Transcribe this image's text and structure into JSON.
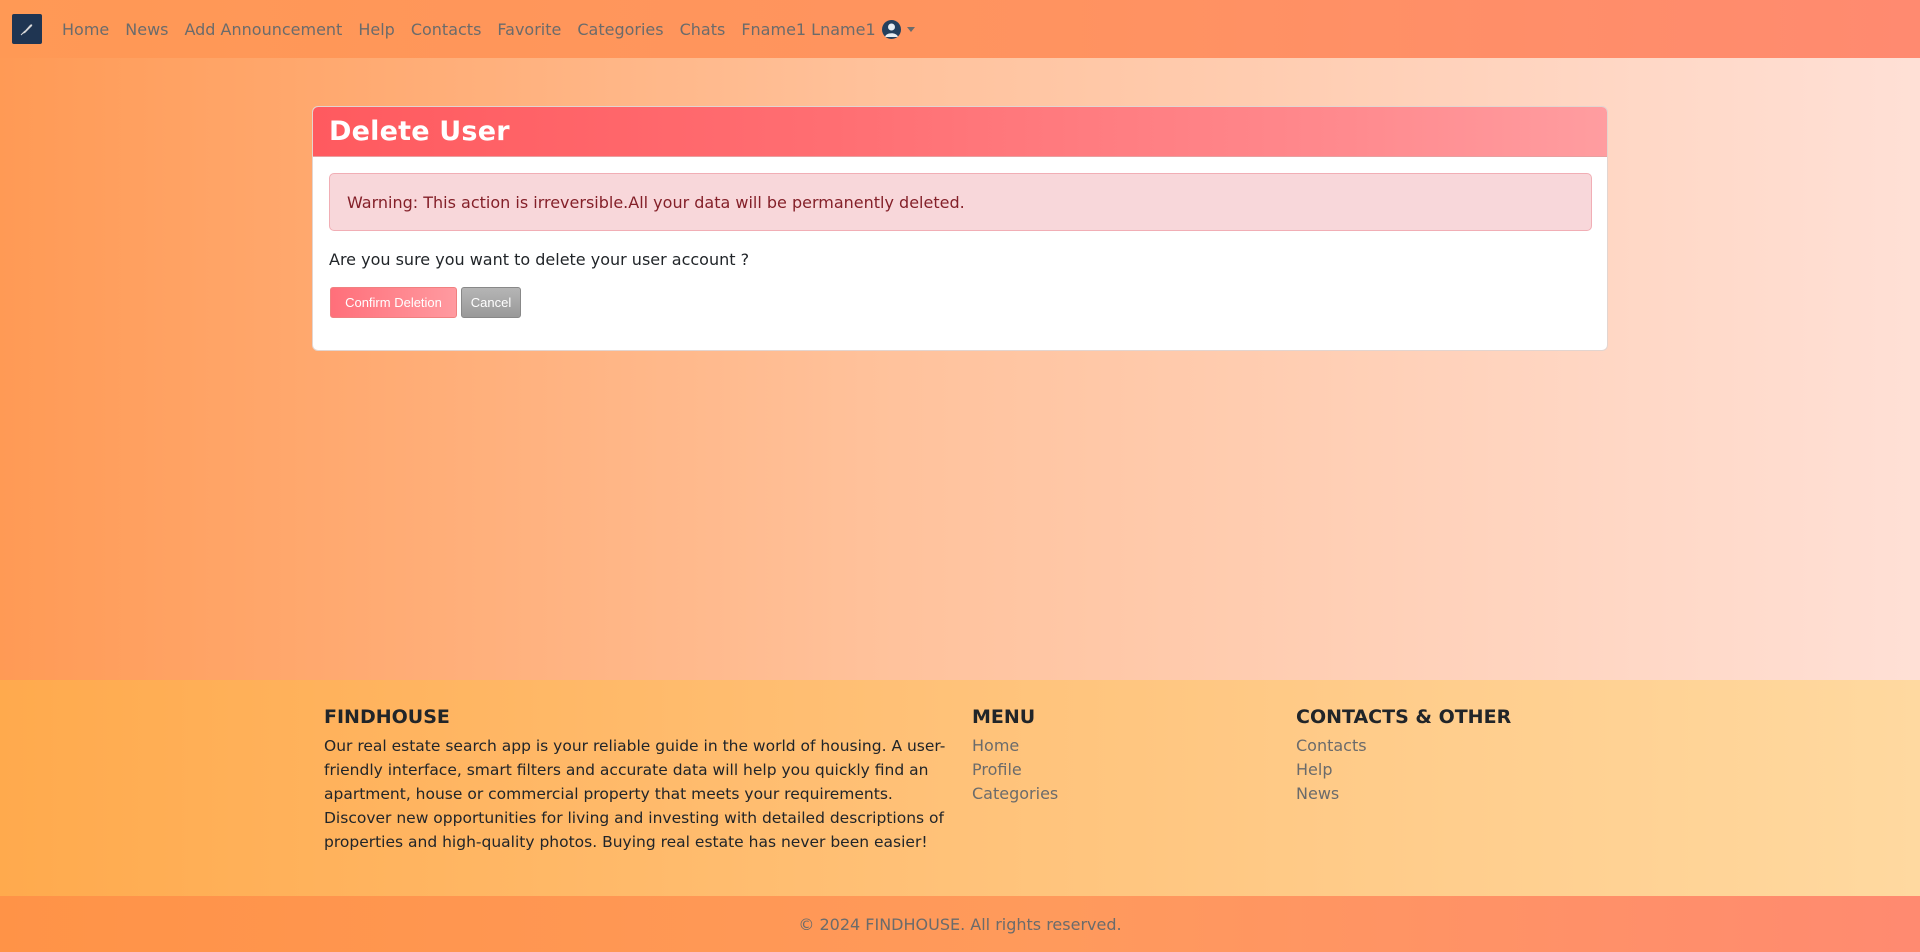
{
  "nav": {
    "logo_icon": "feather-pen-logo",
    "links": [
      "Home",
      "News",
      "Add Announcement",
      "Help",
      "Contacts",
      "Favorite",
      "Categories",
      "Chats"
    ],
    "user_name": "Fname1 Lname1"
  },
  "card": {
    "title": "Delete User",
    "warning": "Warning: This action is irreversible.All your data will be permanently deleted.",
    "question": "Are you sure you want to delete your user account ?",
    "confirm_label": "Confirm Deletion",
    "cancel_label": "Cancel"
  },
  "footer": {
    "brand_heading": "FINDHOUSE",
    "brand_text": "Our real estate search app is your reliable guide in the world of housing. A user-friendly interface, smart filters and accurate data will help you quickly find an apartment, house or commercial property that meets your requirements. Discover new opportunities for living and investing with detailed descriptions of properties and high-quality photos. Buying real estate has never been easier!",
    "menu_heading": "MENU",
    "menu_links": [
      "Home",
      "Profile",
      "Categories"
    ],
    "contacts_heading": "CONTACTS & OTHER",
    "contacts_links": [
      "Contacts",
      "Help",
      "News"
    ],
    "copyright": "© 2024 FINDHOUSE. All rights reserved."
  },
  "colors": {
    "danger_header": "#ff5a5f",
    "alert_bg": "#f8d7da",
    "alert_text": "#842029",
    "nav_link": "#6b6b6b"
  }
}
